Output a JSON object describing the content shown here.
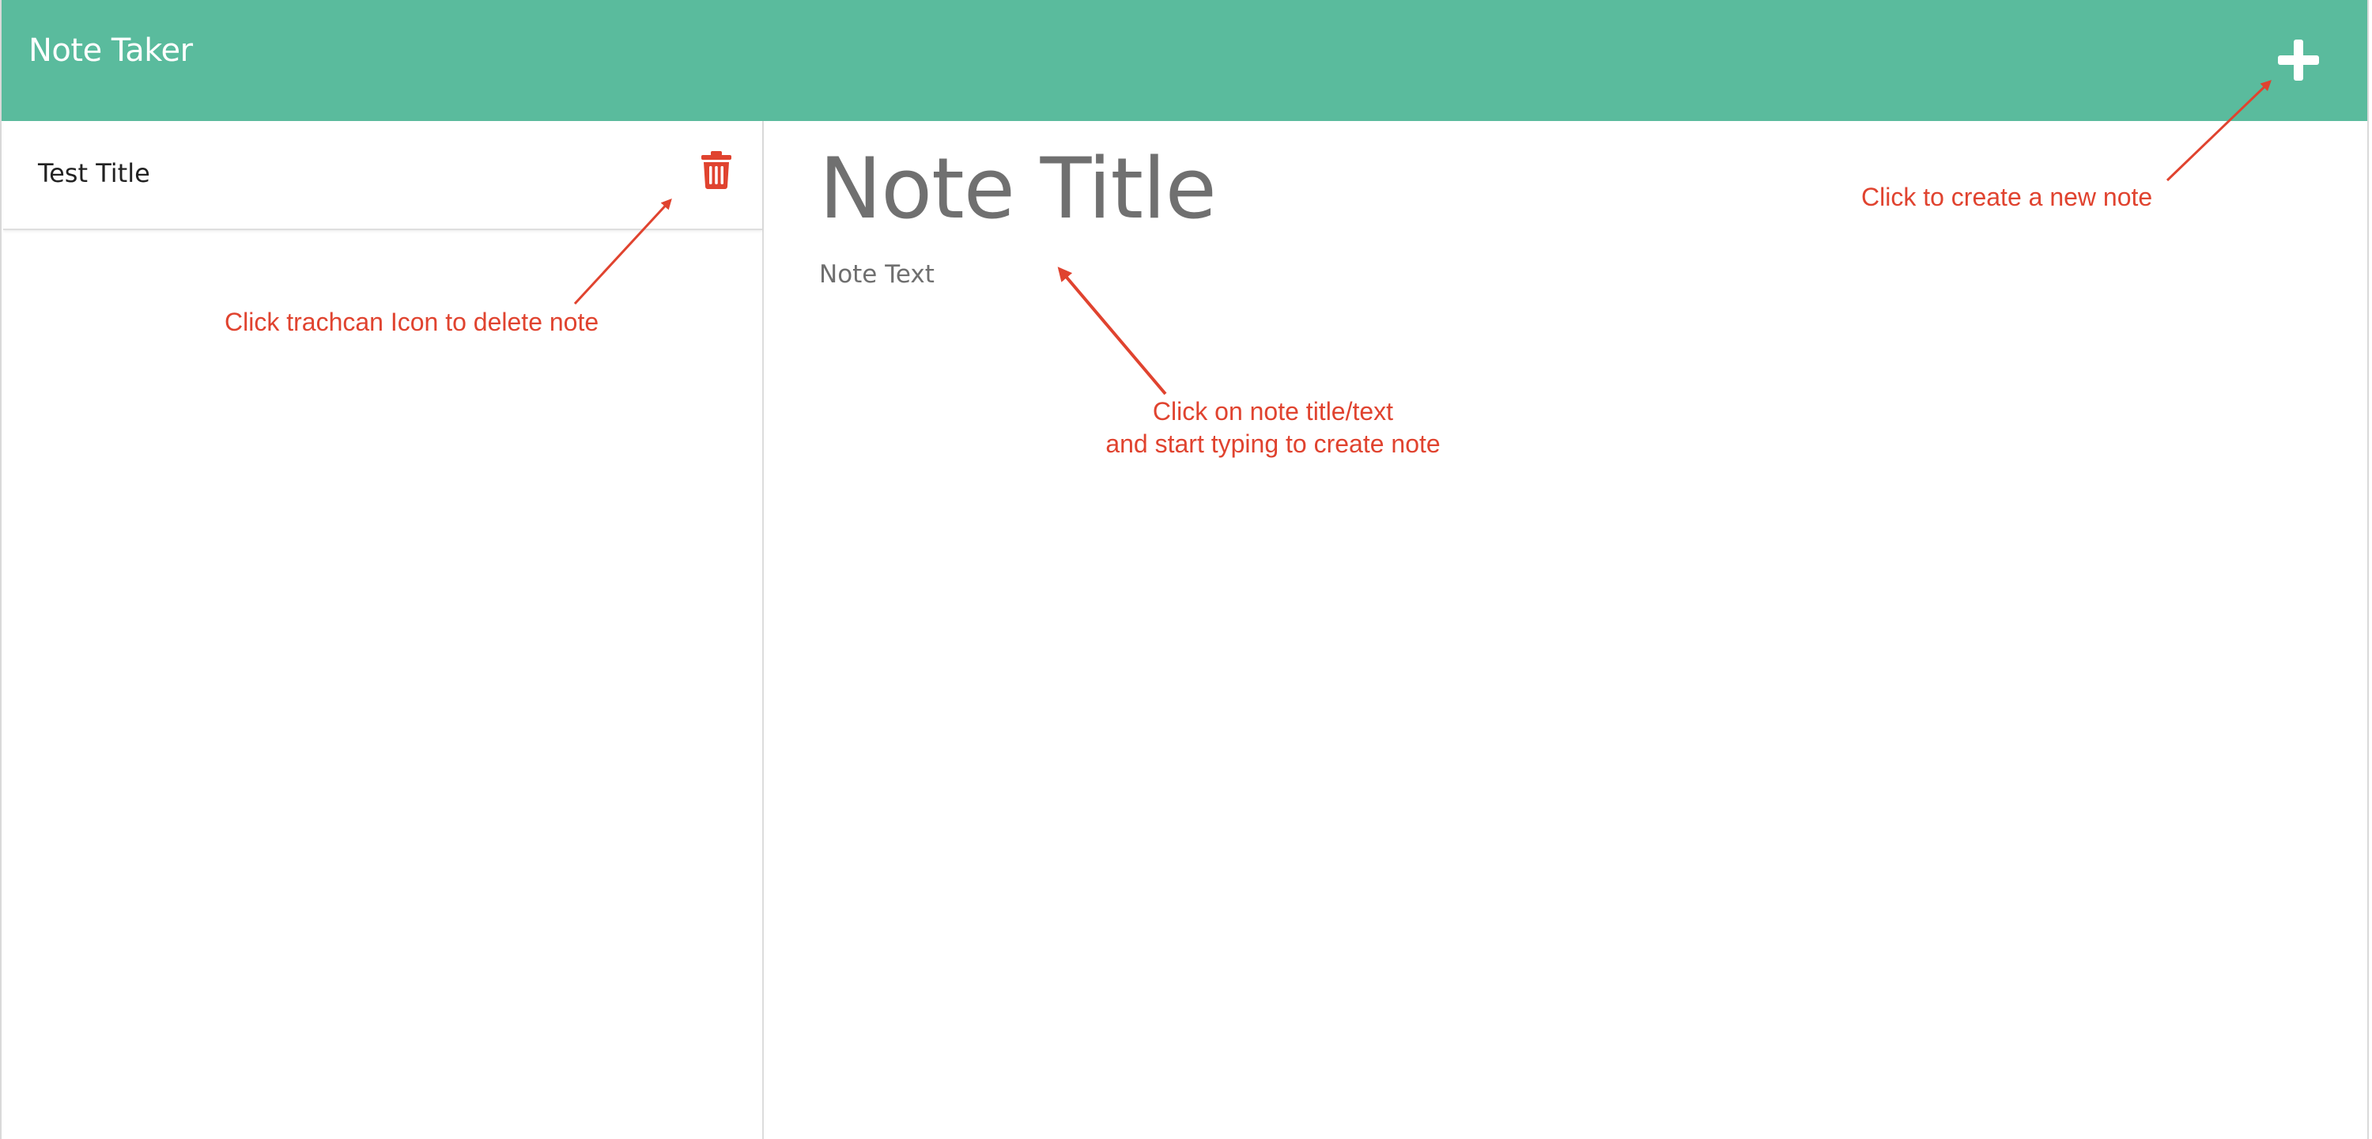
{
  "navbar": {
    "brand": "Note Taker",
    "new_note_icon": "plus-icon"
  },
  "notes_list": [
    {
      "title": "Test Title",
      "delete_icon": "trash-icon"
    }
  ],
  "editor": {
    "title_placeholder": "Note Title",
    "text_placeholder": "Note Text"
  },
  "annotations": {
    "delete_hint": "Click trachcan Icon to delete note",
    "new_note_hint": "Click to create a new note",
    "edit_hint_line1": "Click on note title/text",
    "edit_hint_line2": "and start typing to create note"
  },
  "colors": {
    "navbar_bg": "#5abb9d",
    "annotation": "#e0432f",
    "delete_icon": "#e0432f"
  }
}
